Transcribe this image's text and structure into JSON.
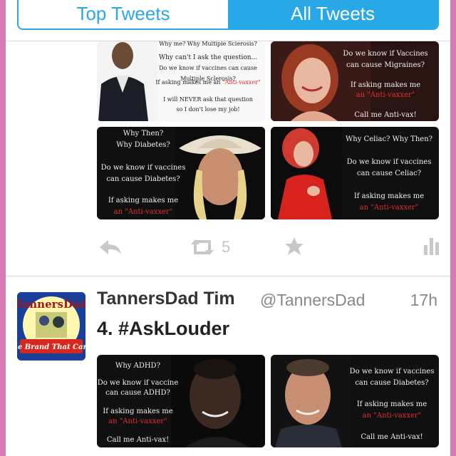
{
  "tabs": {
    "top": "Top Tweets",
    "all": "All Tweets"
  },
  "images1": {
    "ms": {
      "l1": "Why me? Why Multiple Sclerosis?",
      "l2": "Why can't I ask the question...",
      "l3": "Do we know if vaccines can cause Multiple Sclerosis?",
      "l4": "If asking makes me an",
      "red": "\"Anti-vaxxer\"",
      "l5": "I will NEVER ask that question",
      "l6": "so I don't lose my job!"
    },
    "migraine": {
      "l1": "Do we know if Vaccines",
      "l2": "can cause Migraines?",
      "l3": "If asking makes me",
      "red": "an \"Anti-vaxxer\"",
      "l4": "Call me Anti-vax!"
    },
    "diabetes": {
      "l1": "Why Then?",
      "l2": "Why Diabetes?",
      "l3": "Do we know if vaccines",
      "l4": "can cause Diabetes?",
      "l5": "If asking makes me",
      "red": "an \"Anti-vaxxer\""
    },
    "celiac": {
      "l1": "Why Celiac? Why Then?",
      "l2": "Do we know if vaccines",
      "l3": "can cause Celiac?",
      "l4": "If asking makes me",
      "red": "an \"Anti-vaxxer\""
    }
  },
  "actions": {
    "retweet_count": "5"
  },
  "tweet": {
    "name": "TannersDad Tim",
    "handle": "@TannersDad",
    "time": "17h",
    "text": "4. #AskLouder",
    "avatar_top": "TannersDad",
    "avatar_bottom": "The Brand That Cares"
  },
  "images2": {
    "adhd": {
      "l1": "Why ADHD?",
      "l2": "Do we know if vaccine",
      "l3": "can cause ADHD?",
      "l4": "If asking makes me",
      "red": "an \"Anti-vaxxer\"",
      "l5": "Call me Anti-vax!"
    },
    "diabetes2": {
      "l1": "Do we know if vaccines",
      "l2": "can cause Diabetes?",
      "l3": "If asking makes me",
      "red": "an \"Anti-vaxxer\"",
      "l4": "Call me Anti-vax!"
    }
  }
}
